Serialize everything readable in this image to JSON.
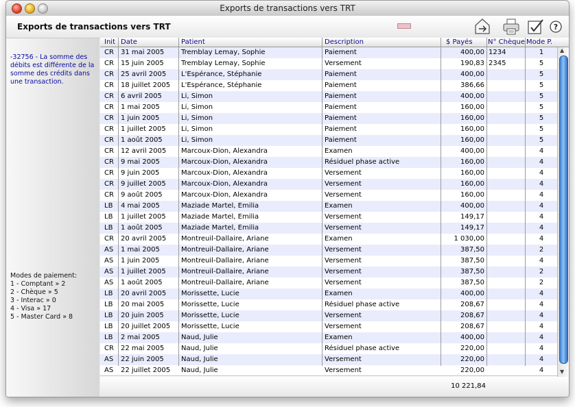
{
  "window": {
    "title": "Exports de transactions vers TRT"
  },
  "header": {
    "title": "Exports de transactions vers TRT"
  },
  "toolbar": {
    "icons": [
      "export-icon",
      "print-icon",
      "check-edit-icon",
      "help-icon"
    ],
    "help_label": "?"
  },
  "sidebar": {
    "error_message": "-32756 - La somme des débits est différente de la somme des crédits dans une transaction.",
    "modes_title": "Modes de paiement:",
    "modes": [
      "1 - Comptant » 2",
      "2 - Chèque » 5",
      "3 - Interac » 0",
      "4 - Visa » 17",
      "5 - Master Card » 8"
    ]
  },
  "table": {
    "columns": [
      "Init",
      "Date",
      "Patient",
      "Description",
      "$ Payés",
      "N° Chèque",
      "Mode P."
    ],
    "rows": [
      [
        "CR",
        "31 mai 2005",
        "Tremblay Lemay, Sophie",
        "Paiement",
        "400,00",
        "1234",
        "1"
      ],
      [
        "CR",
        "15 juin 2005",
        "Tremblay Lemay, Sophie",
        "Versement",
        "190,83",
        "2345",
        "5"
      ],
      [
        "CR",
        "25 avril 2005",
        "L'Espérance, Stéphanie",
        "Paiement",
        "400,00",
        "",
        "5"
      ],
      [
        "CR",
        "18 juillet 2005",
        "L'Espérance, Stéphanie",
        "Paiement",
        "386,66",
        "",
        "5"
      ],
      [
        "CR",
        "6 avril 2005",
        "Li, Simon",
        "Paiement",
        "400,00",
        "",
        "5"
      ],
      [
        "CR",
        "1 mai 2005",
        "Li, Simon",
        "Paiement",
        "160,00",
        "",
        "5"
      ],
      [
        "CR",
        "1 juin 2005",
        "Li, Simon",
        "Paiement",
        "160,00",
        "",
        "5"
      ],
      [
        "CR",
        "1 juillet 2005",
        "Li, Simon",
        "Paiement",
        "160,00",
        "",
        "5"
      ],
      [
        "CR",
        "1 août 2005",
        "Li, Simon",
        "Paiement",
        "160,00",
        "",
        "5"
      ],
      [
        "CR",
        "12 avril 2005",
        "Marcoux-Dion, Alexandra",
        "Examen",
        "400,00",
        "",
        "4"
      ],
      [
        "CR",
        "9 mai 2005",
        "Marcoux-Dion, Alexandra",
        "Résiduel phase active",
        "160,00",
        "",
        "4"
      ],
      [
        "CR",
        "9 juin 2005",
        "Marcoux-Dion, Alexandra",
        "Versement",
        "160,00",
        "",
        "4"
      ],
      [
        "CR",
        "9 juillet 2005",
        "Marcoux-Dion, Alexandra",
        "Versement",
        "160,00",
        "",
        "4"
      ],
      [
        "CR",
        "9 août 2005",
        "Marcoux-Dion, Alexandra",
        "Versement",
        "160,00",
        "",
        "4"
      ],
      [
        "LB",
        "4 mai 2005",
        "Maziade Martel, Emilia",
        "Examen",
        "400,00",
        "",
        "4"
      ],
      [
        "LB",
        "1 juillet 2005",
        "Maziade Martel, Emilia",
        "Versement",
        "149,17",
        "",
        "4"
      ],
      [
        "LB",
        "1 août 2005",
        "Maziade Martel, Emilia",
        "Versement",
        "149,17",
        "",
        "4"
      ],
      [
        "CR",
        "20 avril 2005",
        "Montreuil-Dallaire, Ariane",
        "Examen",
        "1 030,00",
        "",
        "4"
      ],
      [
        "AS",
        "1 mai 2005",
        "Montreuil-Dallaire, Ariane",
        "Versement",
        "387,50",
        "",
        "2"
      ],
      [
        "AS",
        "1 juin 2005",
        "Montreuil-Dallaire, Ariane",
        "Versement",
        "387,50",
        "",
        "4"
      ],
      [
        "AS",
        "1 juillet 2005",
        "Montreuil-Dallaire, Ariane",
        "Versement",
        "387,50",
        "",
        "2"
      ],
      [
        "AS",
        "1 août 2005",
        "Montreuil-Dallaire, Ariane",
        "Versement",
        "387,50",
        "",
        "2"
      ],
      [
        "LB",
        "20 avril 2005",
        "Morissette, Lucie",
        "Examen",
        "400,00",
        "",
        "4"
      ],
      [
        "LB",
        "20 mai 2005",
        "Morissette, Lucie",
        "Résiduel phase active",
        "208,67",
        "",
        "4"
      ],
      [
        "LB",
        "20 juin 2005",
        "Morissette, Lucie",
        "Versement",
        "208,67",
        "",
        "4"
      ],
      [
        "LB",
        "20 juillet 2005",
        "Morissette, Lucie",
        "Versement",
        "208,67",
        "",
        "4"
      ],
      [
        "LB",
        "2 mai 2005",
        "Naud, Julie",
        "Examen",
        "400,00",
        "",
        "4"
      ],
      [
        "CR",
        "22 mai 2005",
        "Naud, Julie",
        "Résiduel phase active",
        "220,00",
        "",
        "4"
      ],
      [
        "AS",
        "22 juin 2005",
        "Naud, Julie",
        "Versement",
        "220,00",
        "",
        "4"
      ],
      [
        "AS",
        "22 juillet 2005",
        "Naud, Julie",
        "Versement",
        "220,00",
        "",
        "4"
      ]
    ],
    "total": "10 221,84"
  }
}
